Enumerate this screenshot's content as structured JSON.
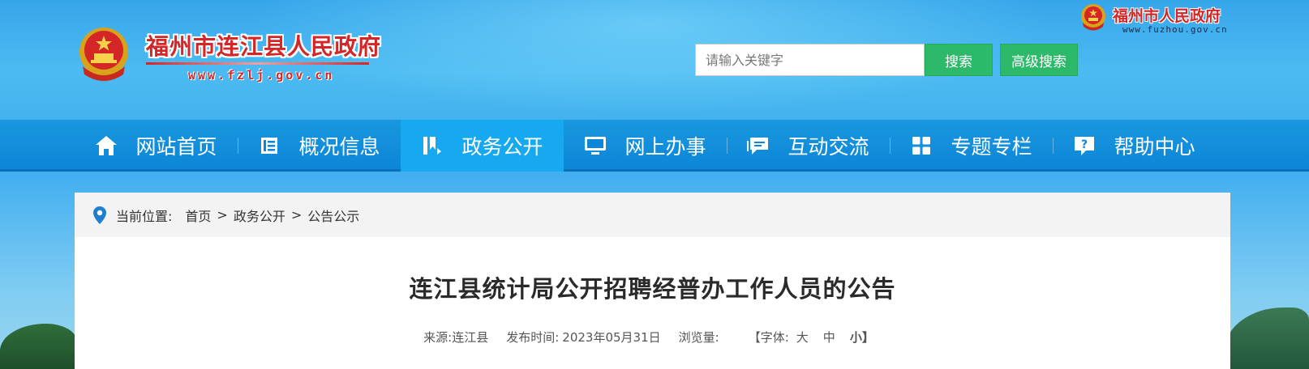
{
  "header": {
    "site_title": "福州市连江县人民政府",
    "site_url": "www.fzlj.gov.cn",
    "city_title": "福州市人民政府",
    "city_url": "www.fuzhou.gov.cn",
    "search_placeholder": "请输入关键字",
    "search_button": "搜索",
    "advanced_search_button": "高级搜索"
  },
  "nav": {
    "items": [
      {
        "label": "网站首页",
        "icon": "home-icon"
      },
      {
        "label": "概况信息",
        "icon": "document-icon"
      },
      {
        "label": "政务公开",
        "icon": "bookmark-icon",
        "active": true
      },
      {
        "label": "网上办事",
        "icon": "monitor-icon"
      },
      {
        "label": "互动交流",
        "icon": "chat-icon"
      },
      {
        "label": "专题专栏",
        "icon": "grid-icon"
      },
      {
        "label": "帮助中心",
        "icon": "help-icon"
      }
    ]
  },
  "breadcrumb": {
    "prefix": "当前位置:",
    "items": [
      "首页",
      "政务公开",
      "公告公示"
    ],
    "separator": ">"
  },
  "article": {
    "title": "连江县统计局公开招聘经普办工作人员的公告",
    "source_label": "来源:",
    "source": "连江县",
    "publish_label": "发布时间:",
    "publish_date": "2023年05月31日",
    "views_label": "浏览量:",
    "font_label": "【字体:",
    "font_large": "大",
    "font_medium": "中",
    "font_small": "小】"
  },
  "colors": {
    "accent_red": "#d42626",
    "nav_blue": "#0c86d6",
    "nav_active": "#16a9ef",
    "button_green": "#2cb96a"
  }
}
